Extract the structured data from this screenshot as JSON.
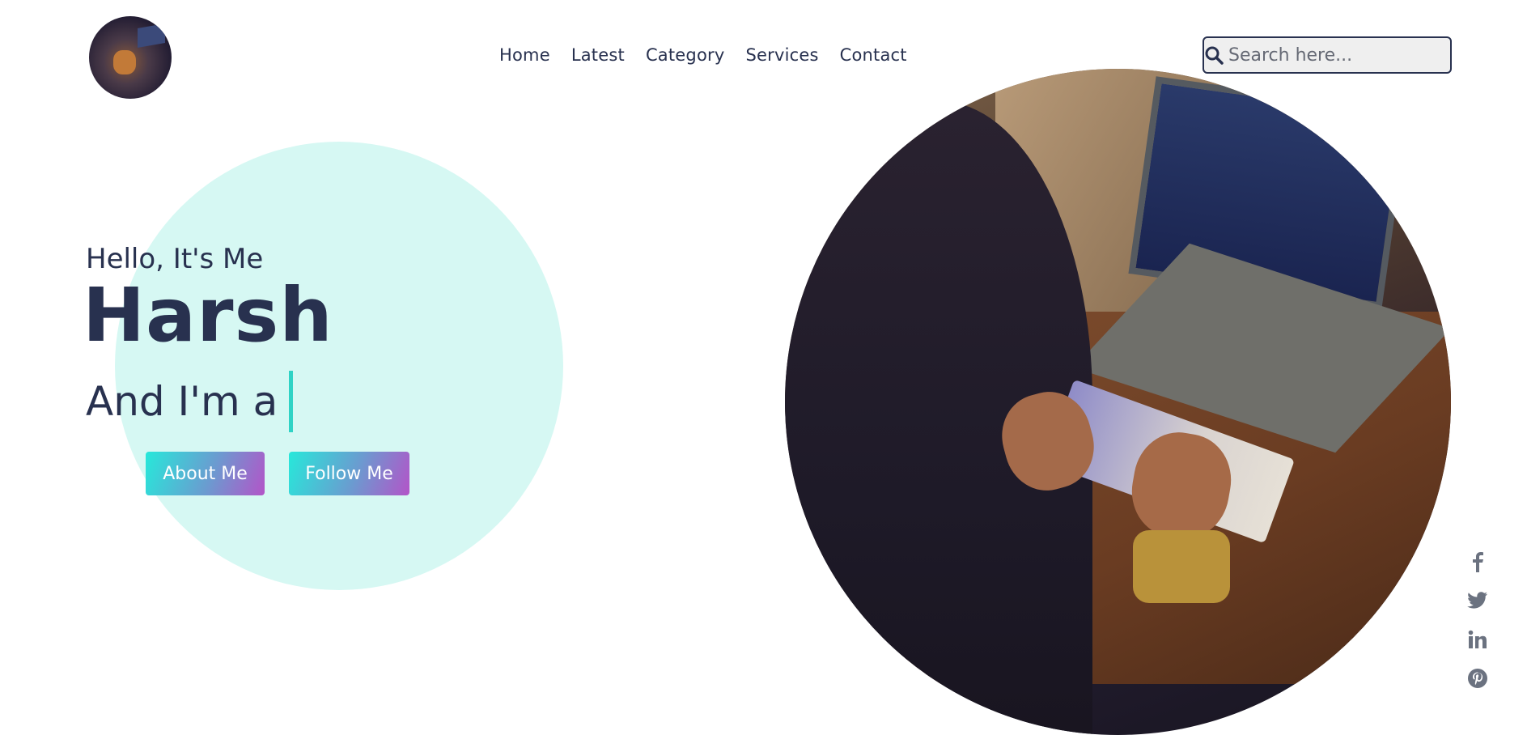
{
  "header": {
    "nav": [
      "Home",
      "Latest",
      "Category",
      "Services",
      "Contact"
    ],
    "search": {
      "placeholder": "Search here..."
    }
  },
  "hero": {
    "greeting": "Hello, It's Me",
    "name": "Harsh",
    "role_prefix": "And I'm a",
    "buttons": {
      "about": "About Me",
      "follow": "Follow Me"
    }
  },
  "social": [
    "facebook-icon",
    "twitter-icon",
    "linkedin-icon",
    "pinterest-icon"
  ],
  "colors": {
    "text": "#28314f",
    "accent": "#2fd3c5",
    "hero_circle": "#d6f8f3",
    "gradient_start": "#27e8da",
    "gradient_end": "#b354c8",
    "social_icon": "#6b7280"
  }
}
